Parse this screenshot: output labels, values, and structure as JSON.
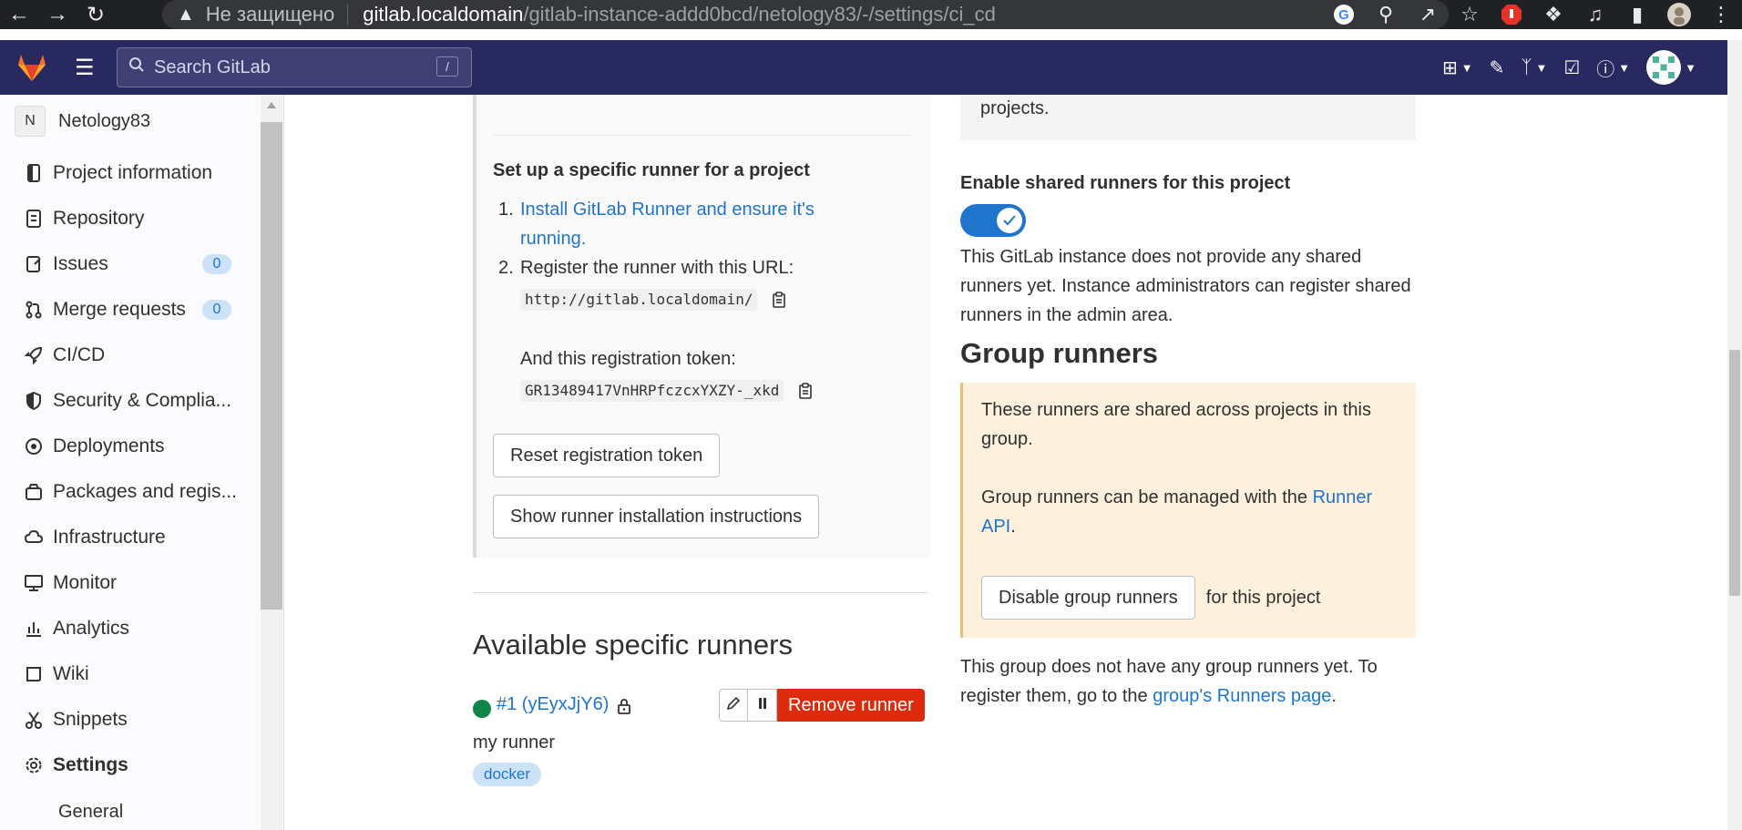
{
  "browser": {
    "insecure_label": "Не защищено",
    "url_host": "gitlab.localdomain",
    "url_path": "/gitlab-instance-addd0bcd/netology83/-/settings/ci_cd"
  },
  "header": {
    "search_placeholder": "Search GitLab",
    "search_shortcut": "/"
  },
  "sidebar": {
    "project_initial": "N",
    "project_name": "Netology83",
    "items": [
      {
        "label": "Project information",
        "icon": "project-info-icon"
      },
      {
        "label": "Repository",
        "icon": "repository-icon"
      },
      {
        "label": "Issues",
        "icon": "issues-icon",
        "count": "0"
      },
      {
        "label": "Merge requests",
        "icon": "merge-request-icon",
        "count": "0"
      },
      {
        "label": "CI/CD",
        "icon": "rocket-icon"
      },
      {
        "label": "Security & Complia...",
        "icon": "shield-icon"
      },
      {
        "label": "Deployments",
        "icon": "deployments-icon"
      },
      {
        "label": "Packages and regis...",
        "icon": "package-icon"
      },
      {
        "label": "Infrastructure",
        "icon": "infrastructure-icon"
      },
      {
        "label": "Monitor",
        "icon": "monitor-icon"
      },
      {
        "label": "Analytics",
        "icon": "analytics-icon"
      },
      {
        "label": "Wiki",
        "icon": "wiki-icon"
      },
      {
        "label": "Snippets",
        "icon": "snippets-icon"
      },
      {
        "label": "Settings",
        "icon": "settings-icon"
      }
    ],
    "sub_general": "General"
  },
  "specific": {
    "heading": "Set up a specific runner for a project",
    "step1_link": "Install GitLab Runner and ensure it's running.",
    "step2_text": "Register the runner with this URL:",
    "url": "http://gitlab.localdomain/",
    "token_label": "And this registration token:",
    "token": "GR13489417VnHRPfczcxYXZY-_xkd",
    "reset_button": "Reset registration token",
    "show_button": "Show runner installation instructions"
  },
  "available": {
    "heading": "Available specific runners",
    "runner_link": "#1 (yEyxJjY6)",
    "remove_button": "Remove runner",
    "runner_description": "my runner",
    "tag": "docker"
  },
  "shared": {
    "note_tail": "projects.",
    "toggle_label": "Enable shared runners for this project",
    "toggle_on": true,
    "description": "This GitLab instance does not provide any shared runners yet. Instance administrators can register shared runners in the admin area."
  },
  "group": {
    "heading": "Group runners",
    "box_text1": "These runners are shared across projects in this group.",
    "box_text2_prefix": "Group runners can be managed with the ",
    "box_text2_link": "Runner API",
    "box_text2_suffix": ".",
    "disable_button": "Disable group runners",
    "for_project": "for this project",
    "footer_prefix": "This group does not have any group runners yet. To register them, go to the ",
    "footer_link": "group's Runners page",
    "footer_suffix": "."
  },
  "colors": {
    "header_bg": "#292961",
    "link": "#1f75cb",
    "danger": "#dd2b0e",
    "online": "#108548",
    "warning_bg": "#fdf1dd"
  }
}
